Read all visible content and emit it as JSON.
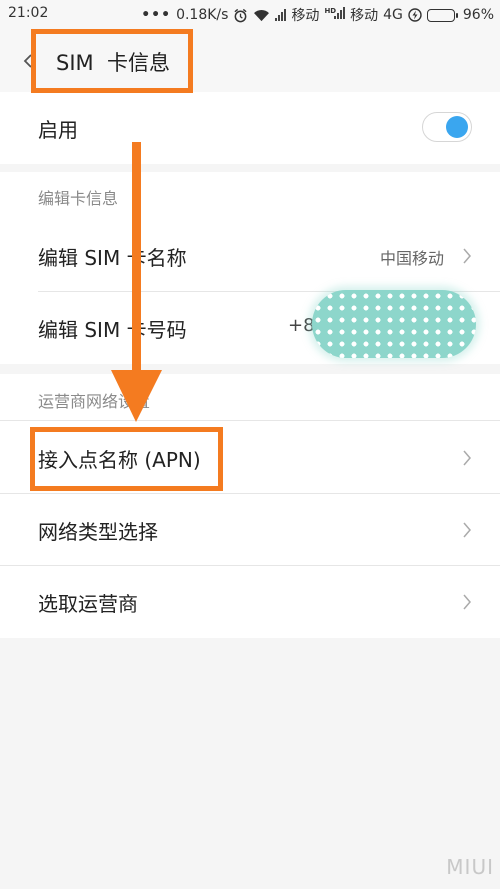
{
  "status_bar": {
    "time": "21:02",
    "dots": "•••",
    "speed": "0.18K/s",
    "carrier1": "移动",
    "carrier2": "移动",
    "hd": "HD",
    "network": "4G",
    "battery_percent": "96%",
    "battery_level": 0.96,
    "icons": [
      "alarm-icon",
      "wifi-icon",
      "signal-icon",
      "charging-icon",
      "battery-icon"
    ]
  },
  "header": {
    "title": "SIM  卡信息",
    "back_icon": "chevron-left-icon"
  },
  "enable": {
    "label": "启用",
    "toggle_on": true,
    "toggle_color": "#3aa6ef"
  },
  "card_info": {
    "section_label": "编辑卡信息",
    "items": [
      {
        "label": "编辑 SIM 卡名称",
        "value": "中国移动"
      },
      {
        "label": "编辑 SIM 卡号码",
        "value": "+8"
      }
    ]
  },
  "network": {
    "section_label": "运营商网络设置",
    "items": [
      {
        "label": "接入点名称 (APN)"
      },
      {
        "label": "网络类型选择"
      },
      {
        "label": "选取运营商"
      }
    ]
  },
  "annotation_color": "#f47b20",
  "watermark": "MIUI"
}
